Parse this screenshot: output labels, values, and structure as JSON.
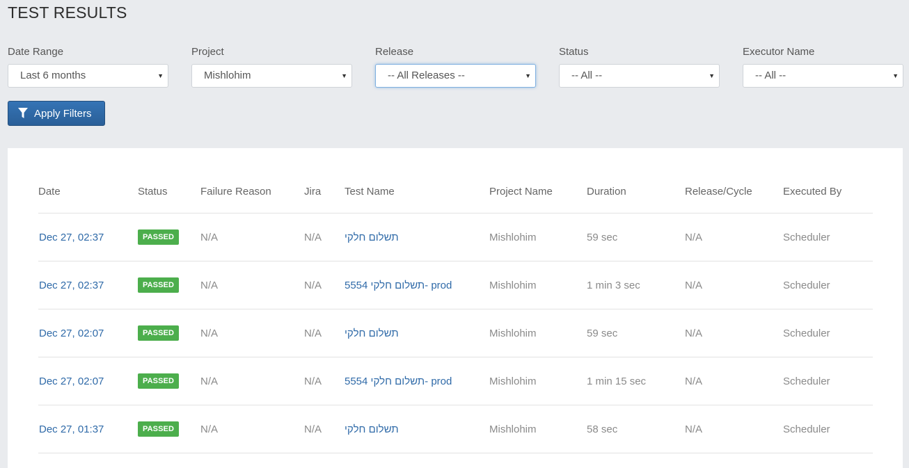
{
  "page_title": "TEST RESULTS",
  "filters": [
    {
      "label": "Date Range",
      "value": "Last 6 months"
    },
    {
      "label": "Project",
      "value": "Mishlohim"
    },
    {
      "label": "Release",
      "value": "-- All Releases --"
    },
    {
      "label": "Status",
      "value": "-- All --"
    },
    {
      "label": "Executor Name",
      "value": "-- All --"
    }
  ],
  "apply_button": {
    "label": "Apply Filters",
    "icon": "filter-icon"
  },
  "table": {
    "headers": [
      "Date",
      "Status",
      "Failure Reason",
      "Jira",
      "Test Name",
      "Project Name",
      "Duration",
      "Release/Cycle",
      "Executed By"
    ],
    "rows": [
      {
        "date": "Dec 27, 02:37",
        "status": "PASSED",
        "failure_reason": "N/A",
        "jira": "N/A",
        "test_name": "תשלום חלקי",
        "project": "Mishlohim",
        "duration": "59 sec",
        "release": "N/A",
        "executed_by": "Scheduler"
      },
      {
        "date": "Dec 27, 02:37",
        "status": "PASSED",
        "failure_reason": "N/A",
        "jira": "N/A",
        "test_name": "5554 תשלום חלקי- prod",
        "project": "Mishlohim",
        "duration": "1 min 3 sec",
        "release": "N/A",
        "executed_by": "Scheduler"
      },
      {
        "date": "Dec 27, 02:07",
        "status": "PASSED",
        "failure_reason": "N/A",
        "jira": "N/A",
        "test_name": "תשלום חלקי",
        "project": "Mishlohim",
        "duration": "59 sec",
        "release": "N/A",
        "executed_by": "Scheduler"
      },
      {
        "date": "Dec 27, 02:07",
        "status": "PASSED",
        "failure_reason": "N/A",
        "jira": "N/A",
        "test_name": "5554 תשלום חלקי- prod",
        "project": "Mishlohim",
        "duration": "1 min 15 sec",
        "release": "N/A",
        "executed_by": "Scheduler"
      },
      {
        "date": "Dec 27, 01:37",
        "status": "PASSED",
        "failure_reason": "N/A",
        "jira": "N/A",
        "test_name": "תשלום חלקי",
        "project": "Mishlohim",
        "duration": "58 sec",
        "release": "N/A",
        "executed_by": "Scheduler"
      }
    ]
  },
  "colors": {
    "background": "#e9ebee",
    "accent": "#2f6aa8",
    "passed_badge": "#4cae4c"
  }
}
